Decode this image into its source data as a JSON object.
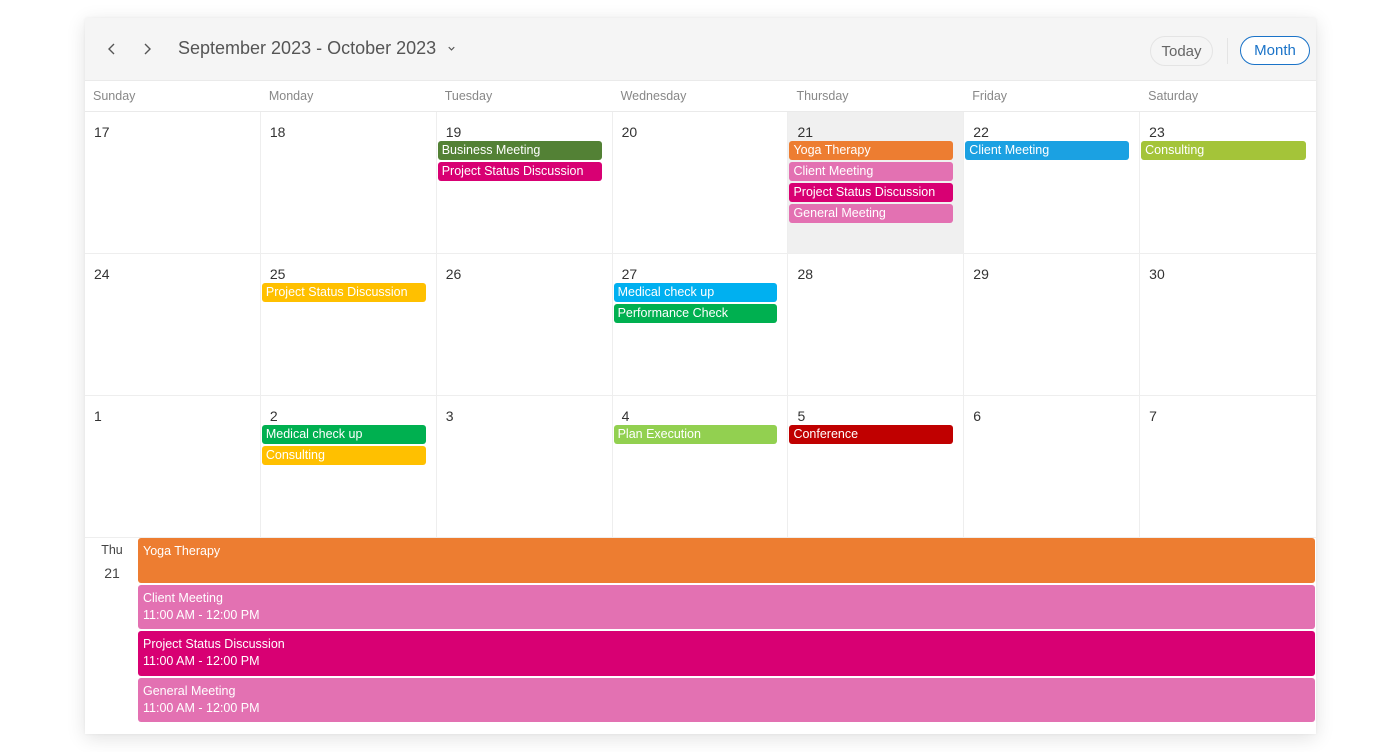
{
  "header": {
    "title": "September 2023 - October 2023",
    "prev_icon": "chevron-left-icon",
    "next_icon": "chevron-right-icon",
    "dropdown_icon": "chevron-down-icon",
    "today_label": "Today",
    "month_label": "Month"
  },
  "colors": {
    "accent": "#1a73c8",
    "selected_day_bg": "#f0f0f0"
  },
  "days_of_week": [
    "Sunday",
    "Monday",
    "Tuesday",
    "Wednesday",
    "Thursday",
    "Friday",
    "Saturday"
  ],
  "weeks": [
    {
      "days": [
        {
          "num": "17",
          "events": []
        },
        {
          "num": "18",
          "events": []
        },
        {
          "num": "19",
          "events": [
            {
              "title": "Business Meeting",
              "color": "#538135"
            },
            {
              "title": "Project Status Discussion",
              "color": "#d80073"
            }
          ]
        },
        {
          "num": "20",
          "events": []
        },
        {
          "num": "21",
          "selected": true,
          "events": [
            {
              "title": "Yoga Therapy",
              "color": "#ed7d31"
            },
            {
              "title": "Client Meeting",
              "color": "#e371b2"
            },
            {
              "title": "Project Status Discussion",
              "color": "#d80073"
            },
            {
              "title": "General Meeting",
              "color": "#e371b2"
            }
          ]
        },
        {
          "num": "22",
          "events": [
            {
              "title": "Client Meeting",
              "color": "#1ba1e2"
            }
          ]
        },
        {
          "num": "23",
          "events": [
            {
              "title": "Consulting",
              "color": "#a4c439"
            }
          ]
        }
      ]
    },
    {
      "days": [
        {
          "num": "24",
          "events": []
        },
        {
          "num": "25",
          "events": [
            {
              "title": "Project Status Discussion",
              "color": "#ffc000"
            }
          ]
        },
        {
          "num": "26",
          "events": []
        },
        {
          "num": "27",
          "events": [
            {
              "title": "Medical check up",
              "color": "#00b0f0"
            },
            {
              "title": "Performance Check",
              "color": "#00b050"
            }
          ]
        },
        {
          "num": "28",
          "events": []
        },
        {
          "num": "29",
          "events": []
        },
        {
          "num": "30",
          "events": []
        }
      ]
    },
    {
      "days": [
        {
          "num": "1",
          "events": []
        },
        {
          "num": "2",
          "events": [
            {
              "title": "Medical check up",
              "color": "#00b050"
            },
            {
              "title": "Consulting",
              "color": "#ffc000"
            }
          ]
        },
        {
          "num": "3",
          "events": []
        },
        {
          "num": "4",
          "events": [
            {
              "title": "Plan Execution",
              "color": "#92d050"
            }
          ]
        },
        {
          "num": "5",
          "events": [
            {
              "title": "Conference",
              "color": "#c00000"
            }
          ]
        },
        {
          "num": "6",
          "events": []
        },
        {
          "num": "7",
          "events": []
        }
      ]
    }
  ],
  "agenda": {
    "day_of_week": "Thu",
    "date": "21",
    "events": [
      {
        "title": "Yoga Therapy",
        "time": "",
        "color": "#ed7d31"
      },
      {
        "title": "Client Meeting",
        "time": "11:00 AM - 12:00 PM",
        "color": "#e371b2"
      },
      {
        "title": "Project Status Discussion",
        "time": "11:00 AM - 12:00 PM",
        "color": "#d80073"
      },
      {
        "title": "General Meeting",
        "time": "11:00 AM - 12:00 PM",
        "color": "#e371b2"
      }
    ]
  }
}
